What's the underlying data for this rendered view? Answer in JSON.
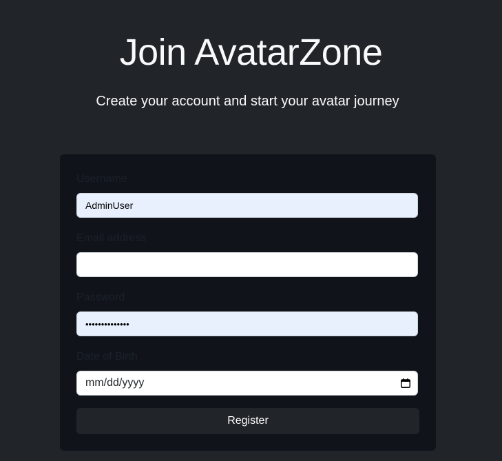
{
  "header": {
    "title": "Join AvatarZone",
    "subtitle": "Create your account and start your avatar journey"
  },
  "form": {
    "username": {
      "label": "Username",
      "value": "AdminUser"
    },
    "email": {
      "label": "Email address",
      "value": ""
    },
    "password": {
      "label": "Password",
      "value": "••••••••••••••"
    },
    "dob": {
      "label": "Date of Birth",
      "placeholder": "mm/dd/yyyy",
      "icon": "calendar-icon"
    },
    "submit_label": "Register"
  },
  "colors": {
    "page_background": "#212529",
    "card_background": "#10141a",
    "autofill_background": "#e8f0fe",
    "button_background": "#212529"
  }
}
